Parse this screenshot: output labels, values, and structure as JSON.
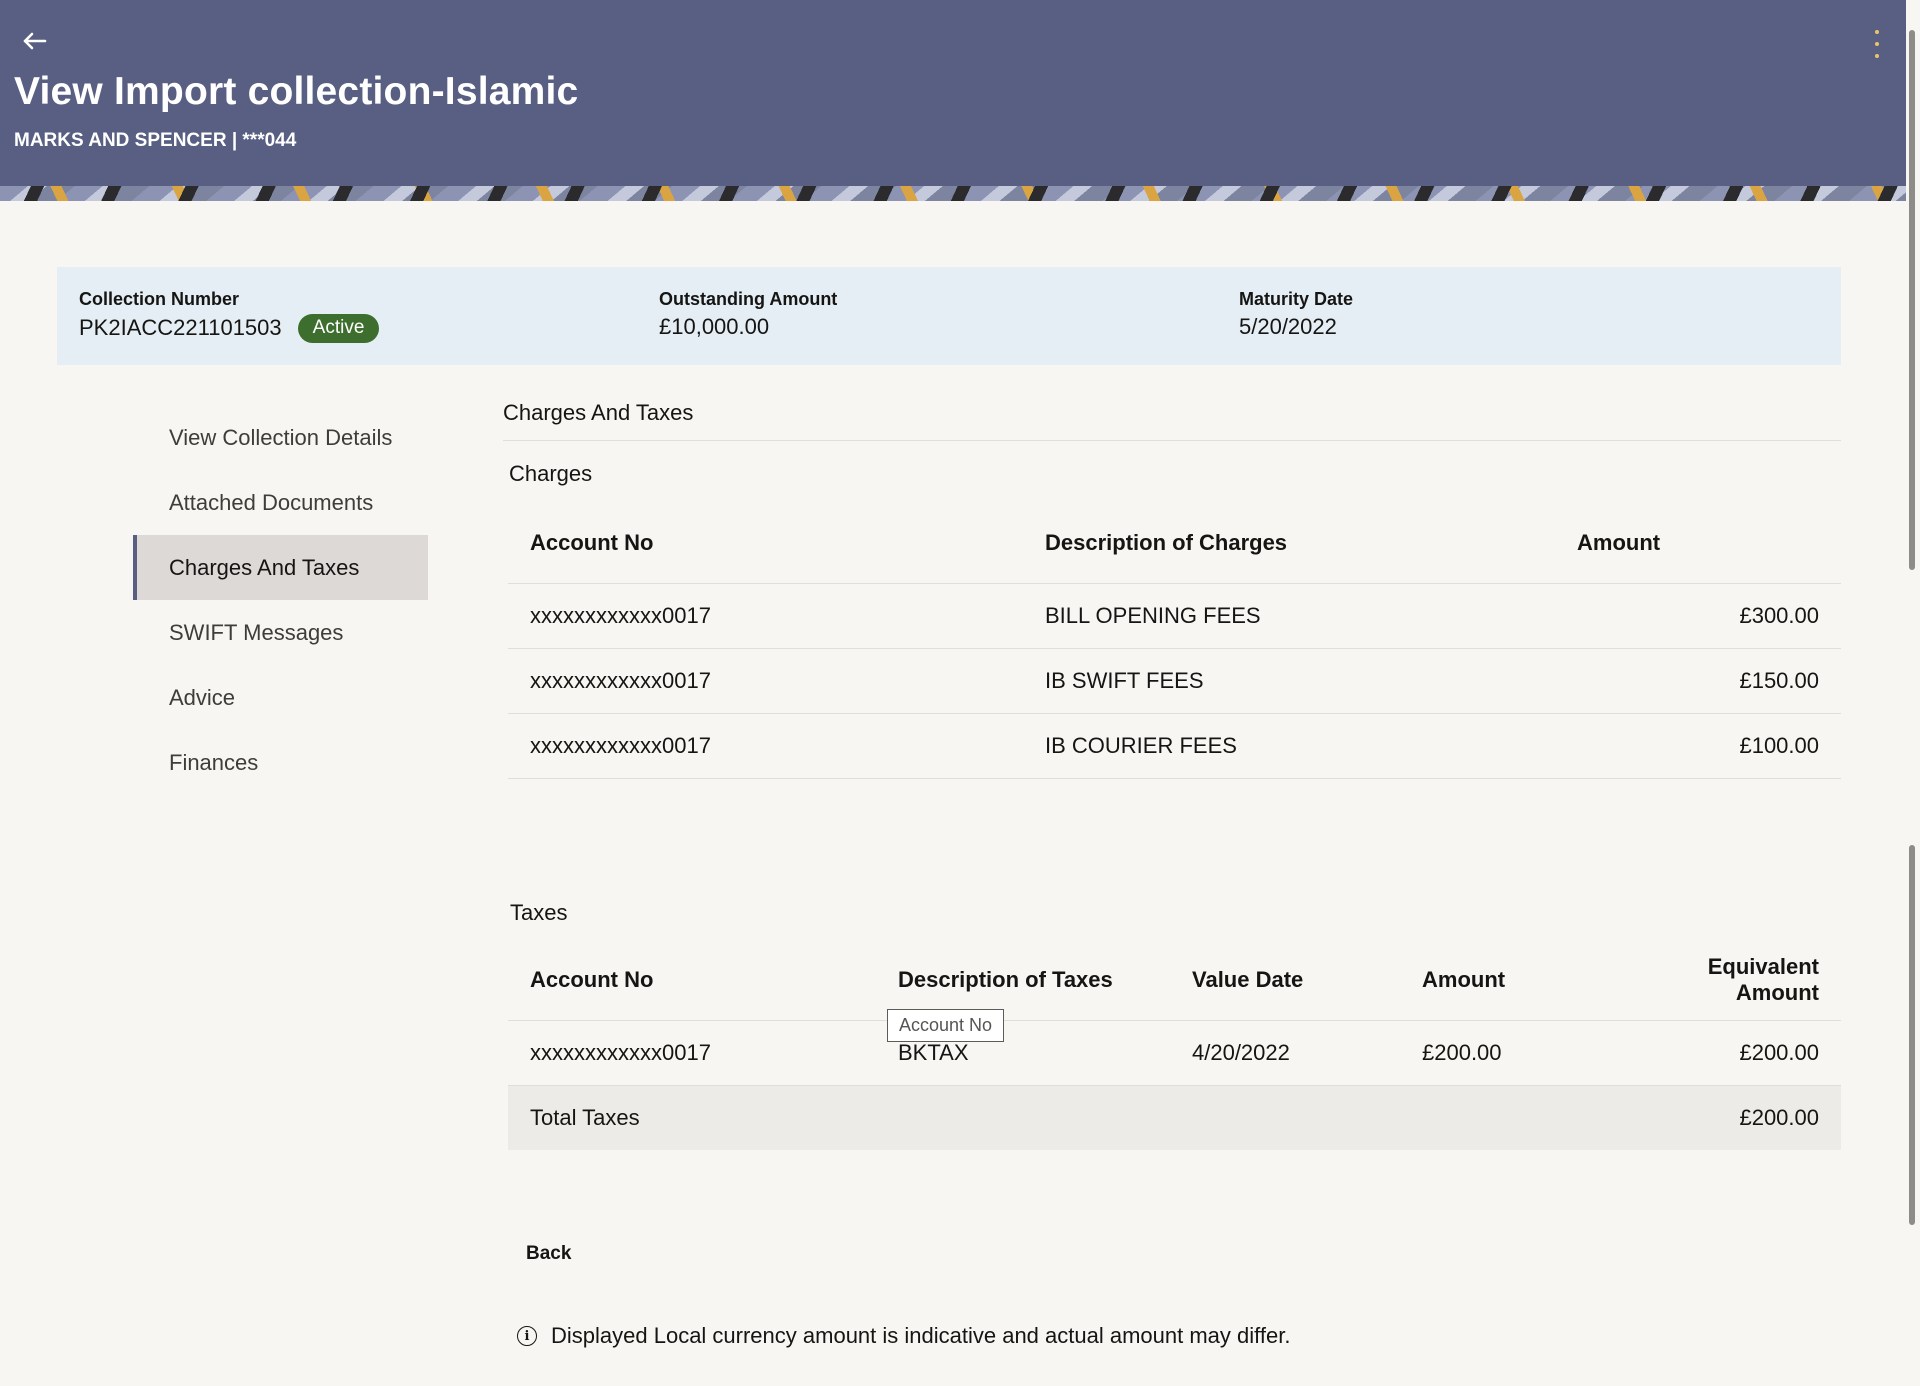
{
  "header": {
    "title": "View Import collection-Islamic",
    "subtitle": "MARKS AND SPENCER | ***044",
    "back_icon": "arrow-left-icon",
    "menu_icon": "kebab-menu-icon"
  },
  "summary": {
    "collection_number_label": "Collection Number",
    "collection_number": "PK2IACC221101503",
    "status": "Active",
    "outstanding_label": "Outstanding Amount",
    "outstanding_value": "£10,000.00",
    "maturity_label": "Maturity Date",
    "maturity_value": "5/20/2022"
  },
  "sidenav": {
    "items": [
      {
        "label": "View Collection Details"
      },
      {
        "label": "Attached Documents"
      },
      {
        "label": "Charges And Taxes"
      },
      {
        "label": "SWIFT Messages"
      },
      {
        "label": "Advice"
      },
      {
        "label": "Finances"
      }
    ],
    "active": "Charges And Taxes"
  },
  "main": {
    "section_title": "Charges And Taxes",
    "charges": {
      "title": "Charges",
      "headers": [
        "Account No",
        "Description of Charges",
        "Amount"
      ],
      "rows": [
        {
          "account": "xxxxxxxxxxxx0017",
          "description": "BILL OPENING FEES",
          "amount": "£300.00"
        },
        {
          "account": "xxxxxxxxxxxx0017",
          "description": "IB SWIFT FEES",
          "amount": "£150.00"
        },
        {
          "account": "xxxxxxxxxxxx0017",
          "description": "IB COURIER FEES",
          "amount": "£100.00"
        }
      ]
    },
    "taxes": {
      "title": "Taxes",
      "headers": [
        "Account No",
        "Description of Taxes",
        "Value Date",
        "Amount",
        "Equivalent",
        "Amount"
      ],
      "rows": [
        {
          "account": "xxxxxxxxxxxx0017",
          "description": "BKTAX",
          "value_date": "4/20/2022",
          "amount": "£200.00",
          "equivalent": "£200.00"
        }
      ],
      "total_label": "Total Taxes",
      "total_value": "£200.00"
    },
    "tooltip": "Account No",
    "back_label": "Back",
    "info_icon": "info-icon",
    "note": "Displayed Local currency amount is indicative and actual amount may differ."
  }
}
